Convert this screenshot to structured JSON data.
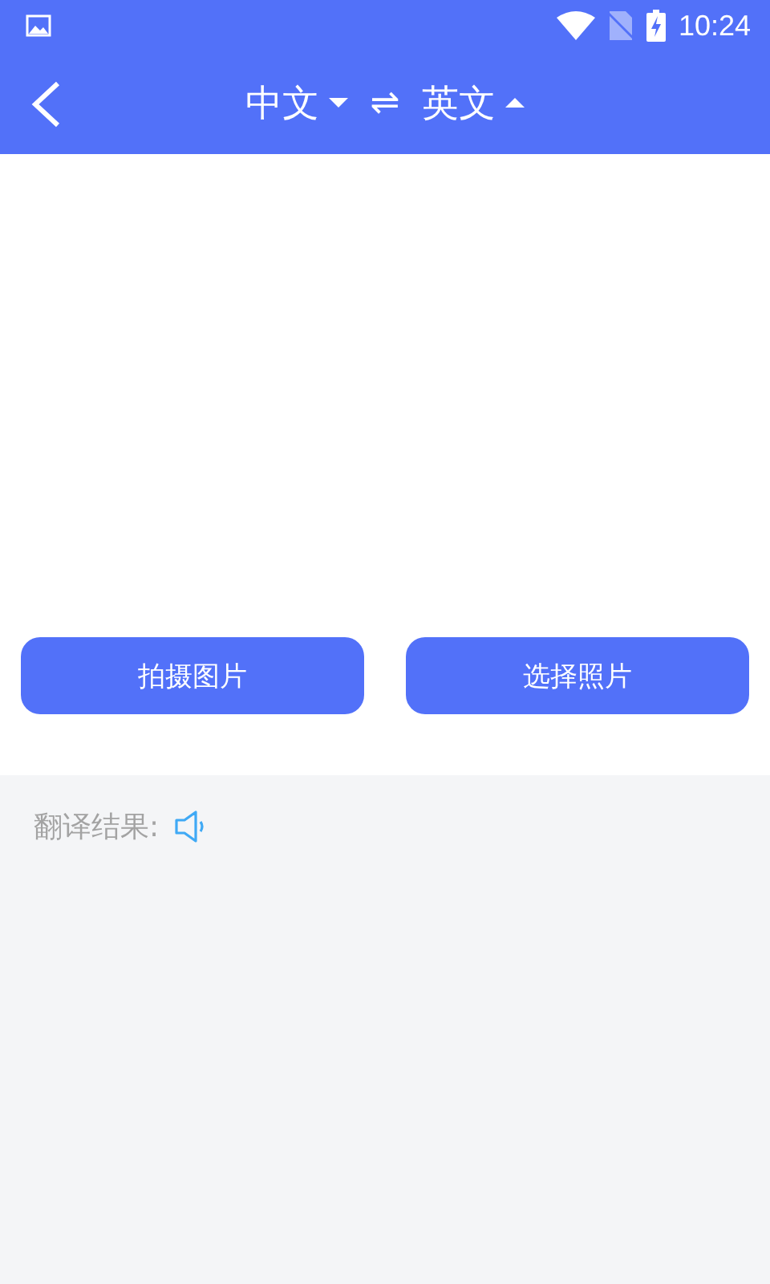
{
  "status_bar": {
    "time": "10:24"
  },
  "header": {
    "languages": [
      {
        "label": "中文",
        "expanded": false
      },
      {
        "label": "英文",
        "expanded": true
      }
    ],
    "swap": "⇌"
  },
  "actions": [
    "拍摄图片",
    "选择照片"
  ],
  "result": {
    "label": "翻译结果:"
  }
}
